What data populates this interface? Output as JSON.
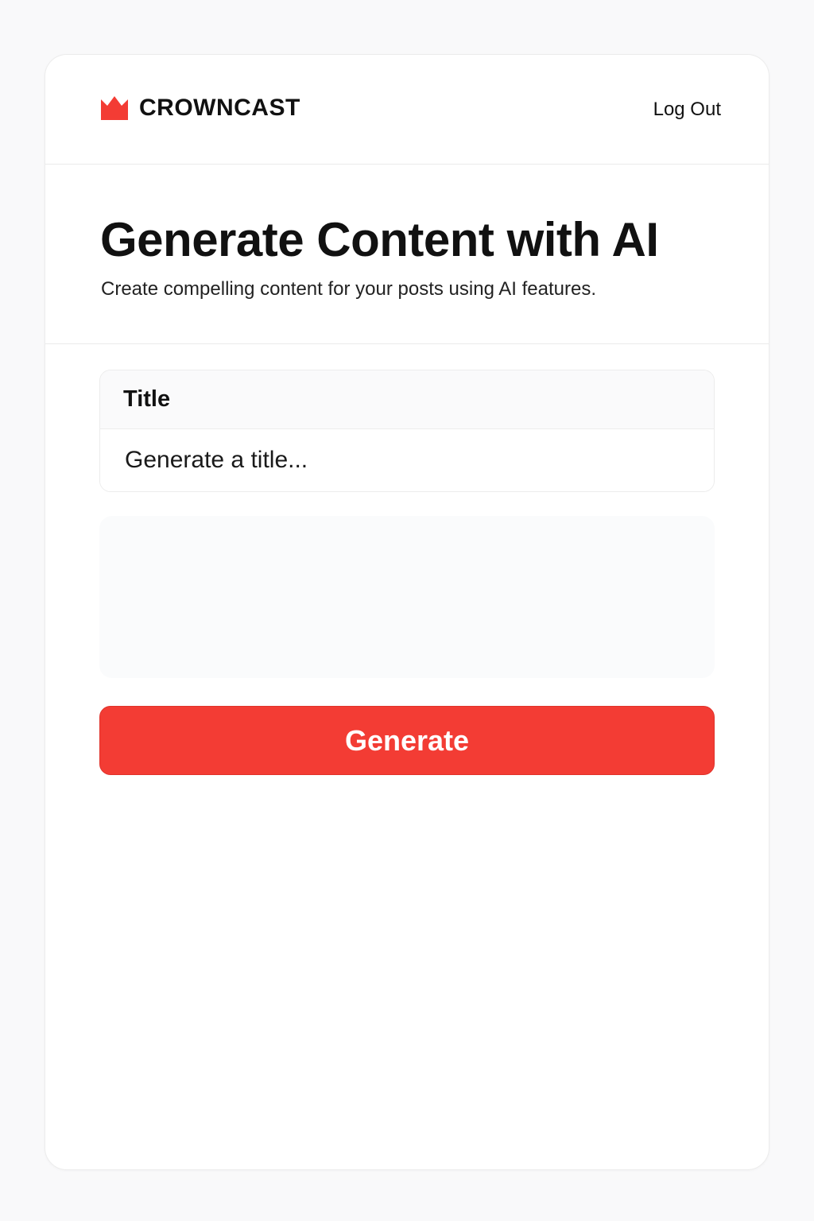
{
  "header": {
    "brand_name": "CROWNCAST",
    "brand_icon": "crown-icon",
    "logout_label": "Log Out"
  },
  "hero": {
    "title": "Generate Content with AI",
    "subtitle": "Create compelling content for your posts using AI features."
  },
  "form": {
    "title_label": "Title",
    "title_placeholder": "Generate a title...",
    "title_value": "",
    "output_value": "",
    "generate_label": "Generate"
  },
  "colors": {
    "accent": "#f33c34",
    "background": "#f9f9fa",
    "card": "#ffffff"
  }
}
